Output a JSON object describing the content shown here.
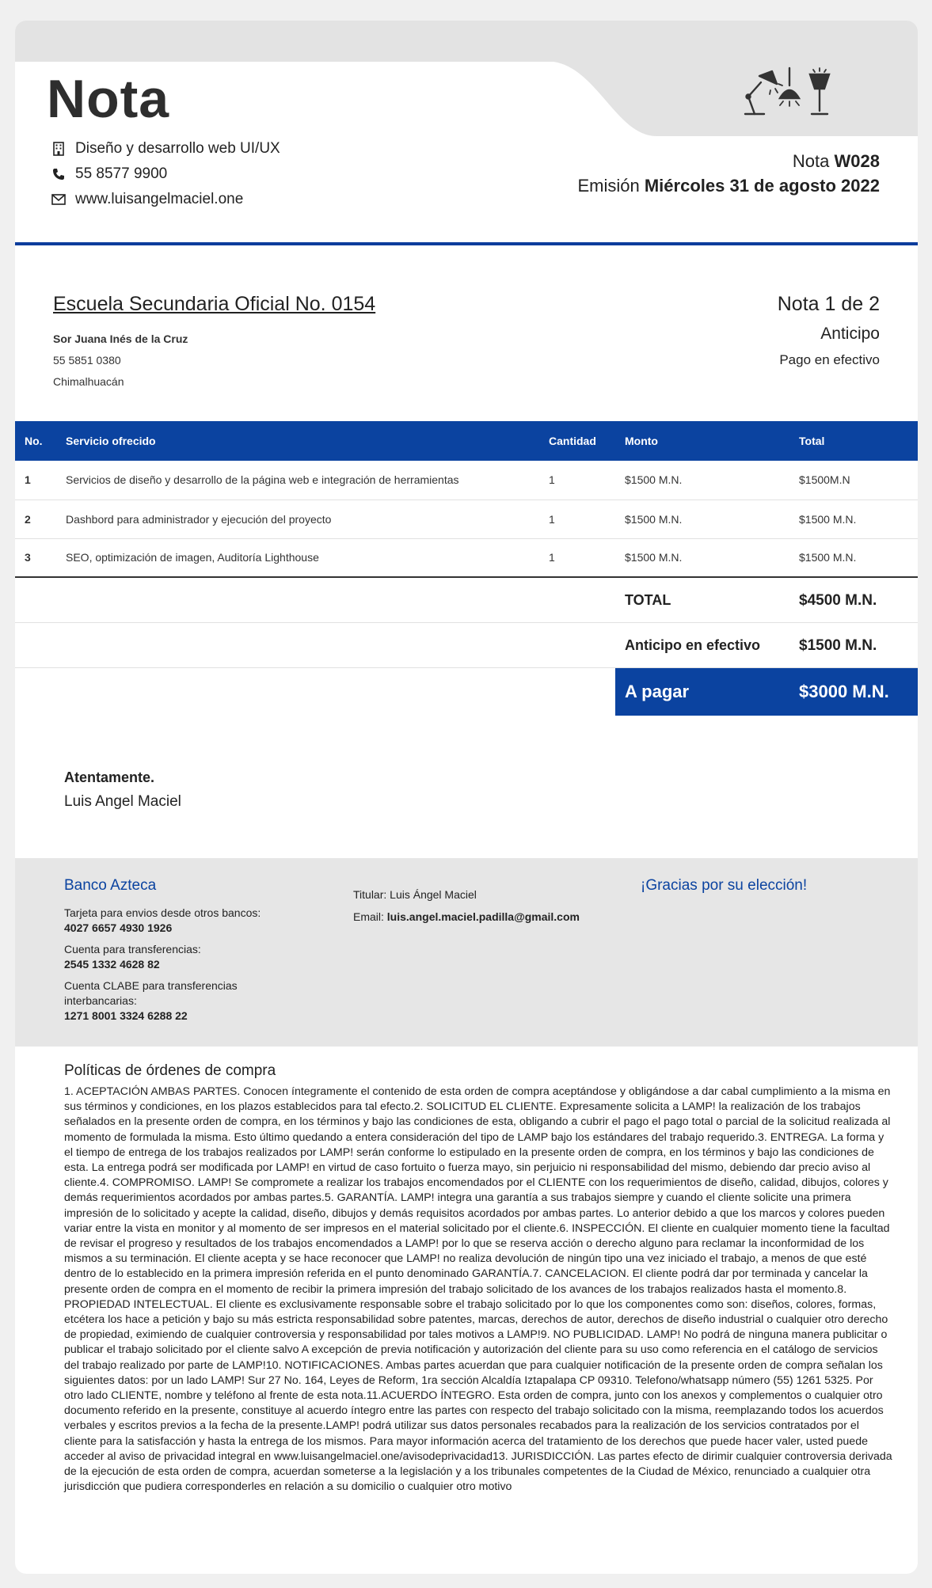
{
  "header": {
    "title": "Nota",
    "contact": {
      "service": "Diseño y desarrollo web UI/UX",
      "phone": "55 8577 9900",
      "website": "www.luisangelmaciel.one"
    },
    "nota_label": "Nota",
    "nota_number": "W028",
    "emision_label": "Emisión",
    "emision_date": "Miércoles 31 de agosto 2022"
  },
  "client": {
    "name": "Escuela Secundaria Oficial No. 0154",
    "subtitle": "Sor Juana Inés de la Cruz",
    "phone": "55 5851 0380",
    "city": "Chimalhuacán",
    "nota_page": "Nota 1 de 2",
    "type": "Anticipo",
    "payment": "Pago en efectivo"
  },
  "table": {
    "headers": [
      "No.",
      "Servicio ofrecido",
      "Cantidad",
      "Monto",
      "Total"
    ],
    "rows": [
      [
        "1",
        "Servicios de diseño y desarrollo de la página web e integración de herramientas",
        "1",
        "$1500 M.N.",
        "$1500M.N"
      ],
      [
        "2",
        "Dashbord para administrador y ejecución del proyecto",
        "1",
        "$1500 M.N.",
        "$1500 M.N."
      ],
      [
        "3",
        "SEO, optimización de imagen, Auditoría Lighthouse",
        "1",
        "$1500 M.N.",
        "$1500 M.N."
      ]
    ]
  },
  "summary": {
    "total_label": "TOTAL",
    "total_value": "$4500 M.N.",
    "advance_label": "Anticipo en efectivo",
    "advance_value": "$1500 M.N.",
    "pay_label": "A pagar",
    "pay_value": "$3000 M.N."
  },
  "signature": {
    "closing": "Atentamente.",
    "name": "Luis Angel Maciel"
  },
  "bank": {
    "name": "Banco Azteca",
    "card_label": "Tarjeta para envios desde otros bancos:",
    "card_number": "4027 6657 4930 1926",
    "account_label": "Cuenta para transferencias:",
    "account_number": "2545 1332 4628 82",
    "clabe_label": "Cuenta CLABE para transferencias interbancarias:",
    "clabe_number": "1271 8001 3324 6288 22",
    "holder": "Titular: Luis Ángel Maciel",
    "email_label": "Email:",
    "email": "luis.angel.maciel.padilla@gmail.com",
    "thanks": "¡Gracias por su elección!"
  },
  "policy": {
    "title": "Políticas de órdenes de compra",
    "text": "1. ACEPTACIÓN AMBAS PARTES. Conocen íntegramente el contenido de esta orden de compra aceptándose y obligándose a dar cabal cumplimiento a la misma en sus términos y condiciones, en los plazos establecidos para tal efecto.2. SOLICITUD EL CLIENTE. Expresamente solicita a LAMP! la realización de los trabajos señalados en la presente orden de compra, en los términos y bajo las condiciones de esta, obligando a cubrir el pago el pago total o parcial de la solicitud realizada al momento de formulada la misma. Esto último quedando a entera consideración del tipo de LAMP bajo los estándares del trabajo requerido.3. ENTREGA. La forma y el tiempo de entrega de los trabajos realizados por LAMP! serán conforme lo estipulado en la presente orden de compra, en los términos y bajo las condiciones de esta. La entrega podrá ser modificada por LAMP! en virtud de caso fortuito o fuerza mayo, sin perjuicio ni responsabilidad del mismo, debiendo dar precio aviso al cliente.4. COMPROMISO. LAMP! Se compromete a realizar los trabajos encomendados por el CLIENTE con los requerimientos de diseño, calidad, dibujos, colores y demás requerimientos acordados por ambas partes.5. GARANTÍA. LAMP! integra una garantía a sus trabajos siempre y cuando el cliente solicite una primera impresión de lo solicitado y acepte la calidad, diseño, dibujos y demás requisitos acordados por ambas partes. Lo anterior debido a que los marcos y colores pueden variar entre la vista en monitor y al momento de ser impresos en el material solicitado por el cliente.6. INSPECCIÓN. El cliente en cualquier momento tiene la facultad de revisar el progreso y resultados de los trabajos encomendados a LAMP! por lo que se reserva acción o derecho alguno para reclamar la inconformidad de los mismos a su terminación. El cliente acepta y se hace reconocer que LAMP! no realiza devolución de ningún tipo una vez iniciado el trabajo, a menos de que esté dentro de lo establecido en la primera impresión referida en el punto denominado GARANTÍA.7. CANCELACION. El cliente podrá dar por terminada y cancelar la presente orden de compra en el momento de recibir la primera impresión del trabajo solicitado de los avances de los trabajos realizados hasta el momento.8. PROPIEDAD INTELECTUAL. El cliente es exclusivamente responsable sobre el trabajo solicitado por lo que los componentes como son: diseños, colores, formas, etcétera los hace a petición y bajo su más estricta responsabilidad sobre patentes, marcas, derechos de autor, derechos de diseño industrial o cualquier otro derecho de propiedad, eximiendo de cualquier controversia y responsabilidad por tales motivos a LAMP!9. NO PUBLICIDAD. LAMP! No podrá de ninguna manera publicitar o publicar el trabajo solicitado por el cliente salvo A excepción de previa notificación y autorización del cliente para su uso como referencia en el catálogo de servicios del trabajo realizado por parte de LAMP!10. NOTIFICACIONES. Ambas partes acuerdan que para cualquier notificación de la presente orden de compra señalan los siguientes datos: por un lado LAMP! Sur 27 No. 164, Leyes de Reform, 1ra sección Alcaldía Iztapalapa CP 09310. Telefono/whatsapp número (55) 1261 5325. Por otro lado CLIENTE, nombre y teléfono al frente de esta nota.11.ACUERDO ÍNTEGRO. Esta orden de compra, junto con los anexos y complementos o cualquier otro documento referido en la presente, constituye al acuerdo íntegro entre las partes con respecto del trabajo solicitado con la misma, reemplazando todos los acuerdos verbales y escritos previos a la fecha de la presente.LAMP! podrá utilizar sus datos personales recabados para la realización de los servicios contratados por el cliente para la satisfacción y hasta la entrega de los mismos. Para mayor información acerca del tratamiento de los derechos que puede hacer valer, usted puede acceder al aviso de privacidad integral en www.luisangelmaciel.one/avisodeprivacidad13. JURISDICCIÓN. Las partes efecto de dirimir cualquier controversia derivada de la ejecución de esta orden de compra, acuerdan someterse a la legislación y a los tribunales competentes de la Ciudad de México, renunciado a cualquier otra jurisdicción que pudiera corresponderles en relación a su domicilio o cualquier otro motivo"
  }
}
